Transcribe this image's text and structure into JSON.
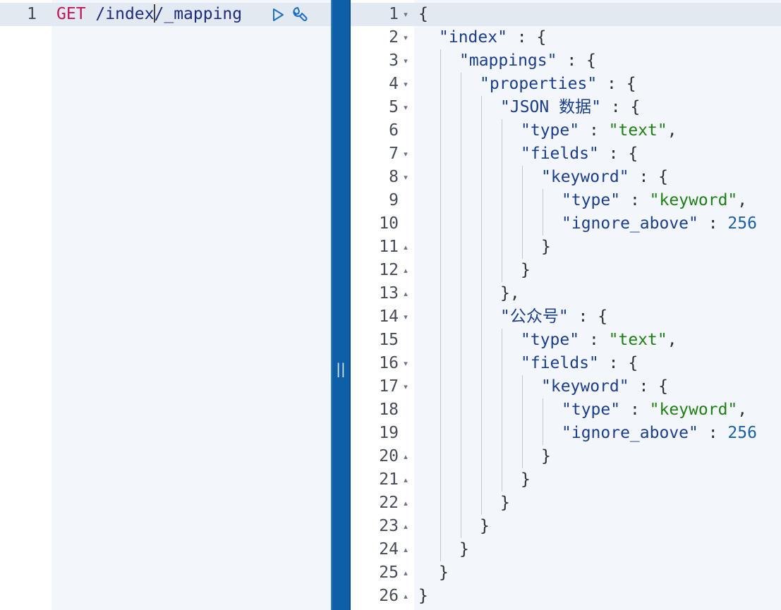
{
  "request": {
    "line_number": "1",
    "method": "GET",
    "path_part1": "/index",
    "path_part2": "/_mapping",
    "actions": [
      {
        "name": "run-request-icon"
      },
      {
        "name": "wrench-icon"
      }
    ]
  },
  "splitter": {
    "grip": "||"
  },
  "response": {
    "lines": [
      {
        "n": "1",
        "fold": "▾",
        "depth": 0,
        "parts": [
          {
            "t": "{",
            "c": "p"
          }
        ]
      },
      {
        "n": "2",
        "fold": "▾",
        "depth": 1,
        "parts": [
          {
            "t": "\"index\"",
            "c": "k"
          },
          {
            "t": " : {",
            "c": "p"
          }
        ]
      },
      {
        "n": "3",
        "fold": "▾",
        "depth": 2,
        "parts": [
          {
            "t": "\"mappings\"",
            "c": "k"
          },
          {
            "t": " : {",
            "c": "p"
          }
        ]
      },
      {
        "n": "4",
        "fold": "▾",
        "depth": 3,
        "parts": [
          {
            "t": "\"properties\"",
            "c": "k"
          },
          {
            "t": " : {",
            "c": "p"
          }
        ]
      },
      {
        "n": "5",
        "fold": "▾",
        "depth": 4,
        "parts": [
          {
            "t": "\"JSON 数据\"",
            "c": "k"
          },
          {
            "t": " : {",
            "c": "p"
          }
        ]
      },
      {
        "n": "6",
        "fold": "",
        "depth": 5,
        "parts": [
          {
            "t": "\"type\"",
            "c": "k"
          },
          {
            "t": " : ",
            "c": "p"
          },
          {
            "t": "\"text\"",
            "c": "s"
          },
          {
            "t": ",",
            "c": "p"
          }
        ]
      },
      {
        "n": "7",
        "fold": "▾",
        "depth": 5,
        "parts": [
          {
            "t": "\"fields\"",
            "c": "k"
          },
          {
            "t": " : {",
            "c": "p"
          }
        ]
      },
      {
        "n": "8",
        "fold": "▾",
        "depth": 6,
        "parts": [
          {
            "t": "\"keyword\"",
            "c": "k"
          },
          {
            "t": " : {",
            "c": "p"
          }
        ]
      },
      {
        "n": "9",
        "fold": "",
        "depth": 7,
        "parts": [
          {
            "t": "\"type\"",
            "c": "k"
          },
          {
            "t": " : ",
            "c": "p"
          },
          {
            "t": "\"keyword\"",
            "c": "s"
          },
          {
            "t": ",",
            "c": "p"
          }
        ]
      },
      {
        "n": "10",
        "fold": "",
        "depth": 7,
        "parts": [
          {
            "t": "\"ignore_above\"",
            "c": "k"
          },
          {
            "t": " : ",
            "c": "p"
          },
          {
            "t": "256",
            "c": "n"
          }
        ]
      },
      {
        "n": "11",
        "fold": "▴",
        "depth": 6,
        "parts": [
          {
            "t": "}",
            "c": "p"
          }
        ]
      },
      {
        "n": "12",
        "fold": "▴",
        "depth": 5,
        "parts": [
          {
            "t": "}",
            "c": "p"
          }
        ]
      },
      {
        "n": "13",
        "fold": "▴",
        "depth": 4,
        "parts": [
          {
            "t": "},",
            "c": "p"
          }
        ]
      },
      {
        "n": "14",
        "fold": "▾",
        "depth": 4,
        "parts": [
          {
            "t": "\"公众号\"",
            "c": "k"
          },
          {
            "t": " : {",
            "c": "p"
          }
        ]
      },
      {
        "n": "15",
        "fold": "",
        "depth": 5,
        "parts": [
          {
            "t": "\"type\"",
            "c": "k"
          },
          {
            "t": " : ",
            "c": "p"
          },
          {
            "t": "\"text\"",
            "c": "s"
          },
          {
            "t": ",",
            "c": "p"
          }
        ]
      },
      {
        "n": "16",
        "fold": "▾",
        "depth": 5,
        "parts": [
          {
            "t": "\"fields\"",
            "c": "k"
          },
          {
            "t": " : {",
            "c": "p"
          }
        ]
      },
      {
        "n": "17",
        "fold": "▾",
        "depth": 6,
        "parts": [
          {
            "t": "\"keyword\"",
            "c": "k"
          },
          {
            "t": " : {",
            "c": "p"
          }
        ]
      },
      {
        "n": "18",
        "fold": "",
        "depth": 7,
        "parts": [
          {
            "t": "\"type\"",
            "c": "k"
          },
          {
            "t": " : ",
            "c": "p"
          },
          {
            "t": "\"keyword\"",
            "c": "s"
          },
          {
            "t": ",",
            "c": "p"
          }
        ]
      },
      {
        "n": "19",
        "fold": "",
        "depth": 7,
        "parts": [
          {
            "t": "\"ignore_above\"",
            "c": "k"
          },
          {
            "t": " : ",
            "c": "p"
          },
          {
            "t": "256",
            "c": "n"
          }
        ]
      },
      {
        "n": "20",
        "fold": "▴",
        "depth": 6,
        "parts": [
          {
            "t": "}",
            "c": "p"
          }
        ]
      },
      {
        "n": "21",
        "fold": "▴",
        "depth": 5,
        "parts": [
          {
            "t": "}",
            "c": "p"
          }
        ]
      },
      {
        "n": "22",
        "fold": "▴",
        "depth": 4,
        "parts": [
          {
            "t": "}",
            "c": "p"
          }
        ]
      },
      {
        "n": "23",
        "fold": "▴",
        "depth": 3,
        "parts": [
          {
            "t": "}",
            "c": "p"
          }
        ]
      },
      {
        "n": "24",
        "fold": "▴",
        "depth": 2,
        "parts": [
          {
            "t": "}",
            "c": "p"
          }
        ]
      },
      {
        "n": "25",
        "fold": "▴",
        "depth": 1,
        "parts": [
          {
            "t": "}",
            "c": "p"
          }
        ]
      },
      {
        "n": "26",
        "fold": "▴",
        "depth": 0,
        "parts": [
          {
            "t": "}",
            "c": "p"
          }
        ]
      }
    ]
  }
}
